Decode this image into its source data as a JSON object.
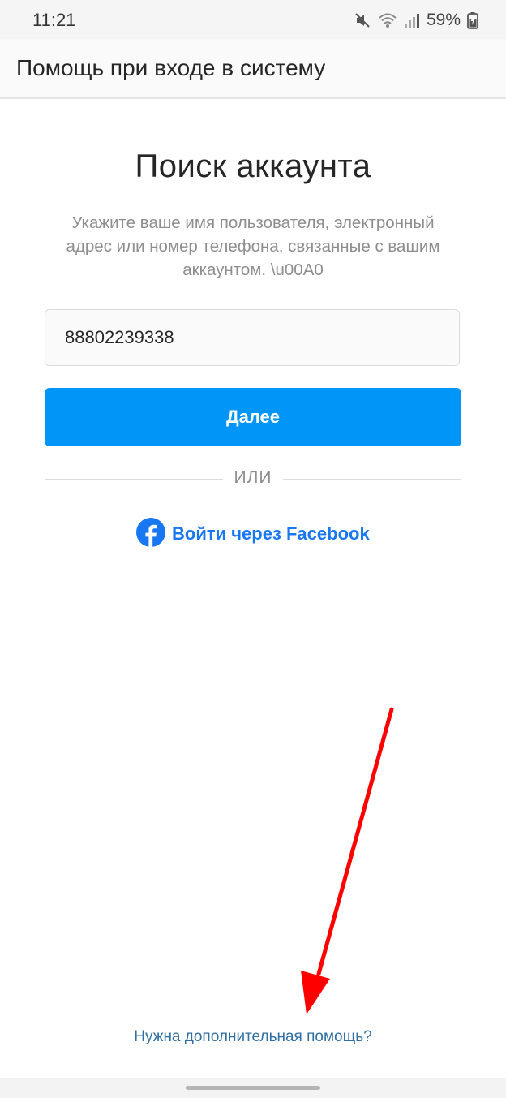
{
  "status_bar": {
    "time": "11:21",
    "battery": "59%",
    "icons": [
      "mute-icon",
      "wifi-icon",
      "signal-icon",
      "battery-charging-icon"
    ]
  },
  "app_bar": {
    "title": "Помощь при входе в систему"
  },
  "main": {
    "heading": "Поиск аккаунта",
    "description": "Укажите ваше имя пользователя, электронный адрес или номер телефона, связанные с вашим аккаунтом. \\u00A0",
    "input_value": "88802239338",
    "next_button": "Далее",
    "divider": "ИЛИ",
    "facebook_login": "Войти через Facebook",
    "facebook_icon": "facebook-icon"
  },
  "footer": {
    "help_link": "Нужна дополнительная помощь?"
  },
  "colors": {
    "primary_blue": "#0095f6",
    "facebook_blue": "#1877f2",
    "annotation_red": "#ff0000"
  }
}
